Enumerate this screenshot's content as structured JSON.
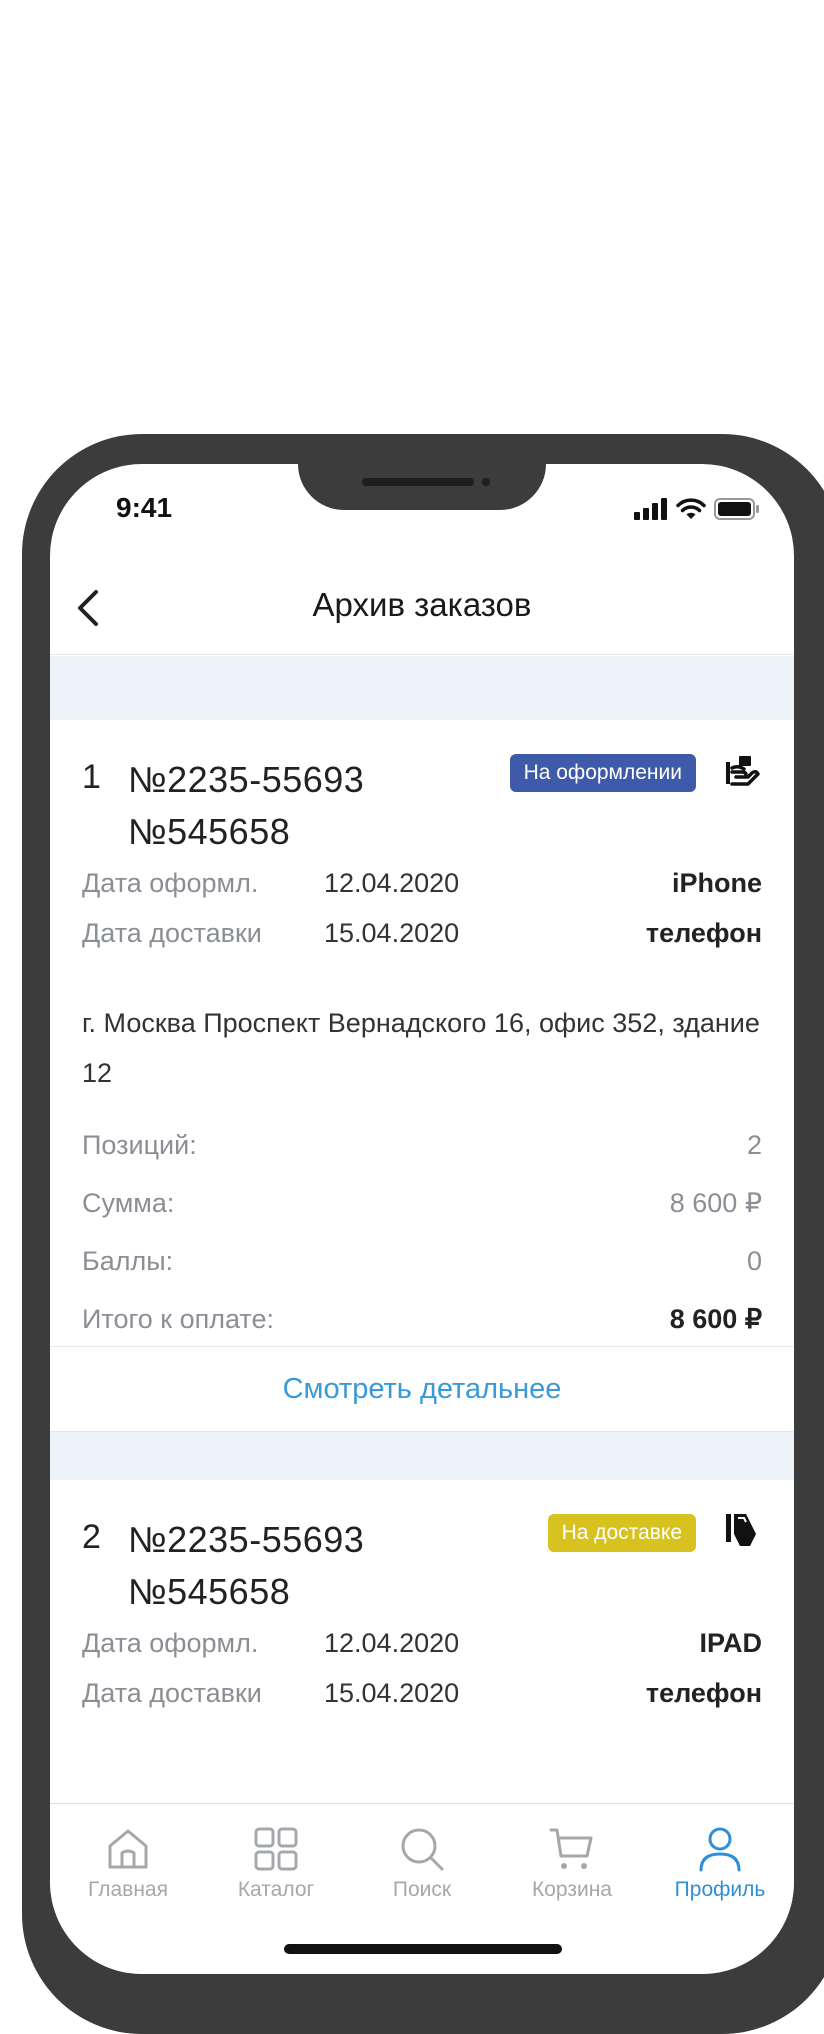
{
  "status_bar": {
    "time": "9:41"
  },
  "header": {
    "title": "Архив заказов"
  },
  "orders": [
    {
      "index": "1",
      "number_1": "№2235-55693",
      "number_2": "№545658",
      "status": "На оформлении",
      "status_color": "#3f5aa9",
      "icon": "hand-box-icon",
      "order_date_label": "Дата оформл.",
      "order_date": "12.04.2020",
      "delivery_date_label": "Дата доставки",
      "delivery_date": "15.04.2020",
      "product_line_1": "iPhone",
      "product_line_2": "телефон",
      "address": "г. Москва Проспект Вернадского 16, офис 352, здание 12",
      "positions_label": "Позиций:",
      "positions": "2",
      "sum_label": "Сумма:",
      "sum": "8 600 ₽",
      "points_label": "Баллы:",
      "points": "0",
      "total_label": "Итого к оплате:",
      "total": "8 600 ₽",
      "details_link": "Смотреть детальнее"
    },
    {
      "index": "2",
      "number_1": "№2235-55693",
      "number_2": "№545658",
      "status": "На доставке",
      "status_color": "#d8c21f",
      "icon": "delivery-card-icon",
      "order_date_label": "Дата оформл.",
      "order_date": "12.04.2020",
      "delivery_date_label": "Дата доставки",
      "delivery_date": "15.04.2020",
      "product_line_1": "IPAD",
      "product_line_2": "телефон"
    }
  ],
  "tabbar": {
    "items": [
      {
        "label": "Главная",
        "icon": "home-icon",
        "active": false
      },
      {
        "label": "Каталог",
        "icon": "grid-icon",
        "active": false
      },
      {
        "label": "Поиск",
        "icon": "search-icon",
        "active": false
      },
      {
        "label": "Корзина",
        "icon": "cart-icon",
        "active": false
      },
      {
        "label": "Профиль",
        "icon": "profile-icon",
        "active": true
      }
    ]
  },
  "colors": {
    "accent": "#2f8fd6",
    "link": "#3a9ad9",
    "section_bg": "#eef3fa",
    "frame": "#3c3c3c"
  }
}
